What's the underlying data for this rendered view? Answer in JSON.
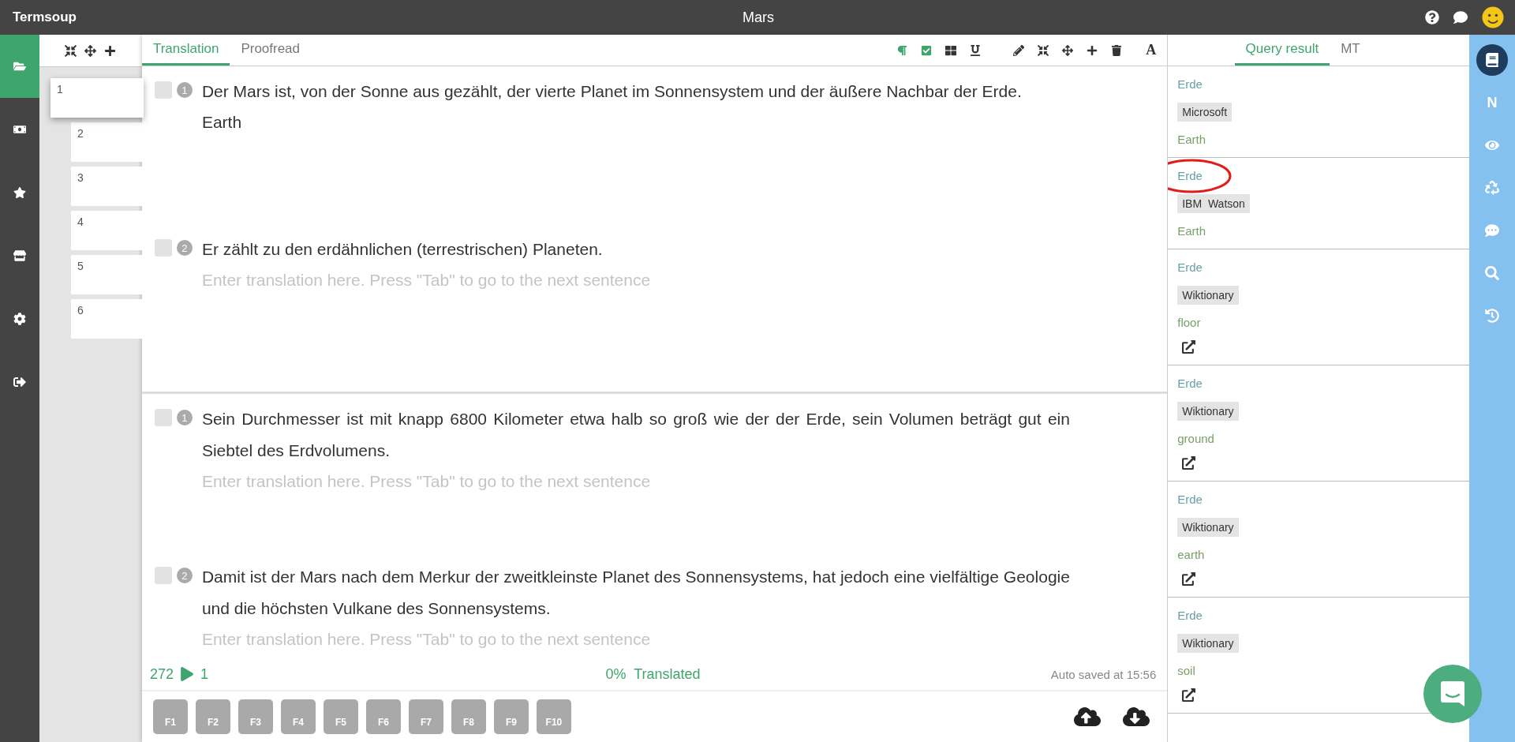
{
  "title_bar": {
    "app_name": "Termsoup",
    "document_title": "Mars"
  },
  "nav": [
    {
      "selected": true
    },
    {
      "selected": false
    },
    {
      "selected": false
    },
    {
      "selected": false
    },
    {
      "selected": false
    },
    {
      "selected": false
    }
  ],
  "pages": [
    {
      "label": "1",
      "selected": true
    },
    {
      "label": "2",
      "selected": false
    },
    {
      "label": "3",
      "selected": false
    },
    {
      "label": "4",
      "selected": false
    },
    {
      "label": "5",
      "selected": false
    },
    {
      "label": "6",
      "selected": false
    }
  ],
  "editor_tabs": [
    {
      "label": "Translation",
      "selected": true
    },
    {
      "label": "Proofread",
      "selected": false
    }
  ],
  "format_toggles": [
    {
      "on": true
    },
    {
      "on": true
    },
    {
      "on": false
    },
    {
      "on": false
    }
  ],
  "font_button": "A",
  "paragraphs": [
    {
      "segments": [
        {
          "number": "1",
          "checked": false,
          "source": "Der Mars ist, von der Sonne aus gezählt, der vierte Planet im Sonnensystem und der äußere Nachbar der Erde.",
          "translation": "Earth"
        },
        {
          "number": "2",
          "checked": false,
          "source": "Er zählt zu den erdähnlichen (terrestrischen) Planeten.",
          "placeholder": "Enter translation here. Press \"Tab\" to go to the next sentence"
        }
      ]
    },
    {
      "segments": [
        {
          "number": "1",
          "checked": false,
          "source": "Sein Durchmesser ist mit knapp 6800 Kilometer etwa halb so groß wie der der Erde, sein Volumen beträgt gut ein Siebtel des Erdvolumens.",
          "placeholder": "Enter translation here. Press \"Tab\" to go to the next sentence"
        },
        {
          "number": "2",
          "checked": false,
          "source": "Damit ist der Mars nach dem Merkur der zweitkleinste Planet des Sonnensystems, hat jedoch eine vielfältige Geologie und die höchsten Vulkane des Sonnensystems.",
          "placeholder": "Enter translation here. Press \"Tab\" to go to the next sentence"
        }
      ]
    }
  ],
  "status": {
    "word_count": "272",
    "segment": "1",
    "progress": "0%  Translated",
    "saved": "Auto saved at 15:56"
  },
  "function_keys": [
    "F1",
    "F2",
    "F3",
    "F4",
    "F5",
    "F6",
    "F7",
    "F8",
    "F9",
    "F10"
  ],
  "results_tabs": [
    {
      "label": "Query result",
      "selected": true
    },
    {
      "label": "MT",
      "selected": false
    }
  ],
  "results": [
    {
      "term": "Erde",
      "source": "Microsoft",
      "translation": "Earth",
      "link": false,
      "highlighted": false
    },
    {
      "term": "Erde",
      "source": "IBM  Watson",
      "translation": "Earth",
      "link": false,
      "highlighted": true
    },
    {
      "term": "Erde",
      "source": "Wiktionary",
      "translation": "floor",
      "link": true
    },
    {
      "term": "Erde",
      "source": "Wiktionary",
      "translation": "ground",
      "link": true
    },
    {
      "term": "Erde",
      "source": "Wiktionary",
      "translation": "earth",
      "link": true
    },
    {
      "term": "Erde",
      "source": "Wiktionary",
      "translation": "soil",
      "link": true
    }
  ],
  "rail": [
    {
      "selected": true
    },
    {
      "selected": false,
      "label": "N"
    },
    {
      "selected": false
    },
    {
      "selected": false
    },
    {
      "selected": false
    },
    {
      "selected": false
    },
    {
      "selected": false
    }
  ]
}
